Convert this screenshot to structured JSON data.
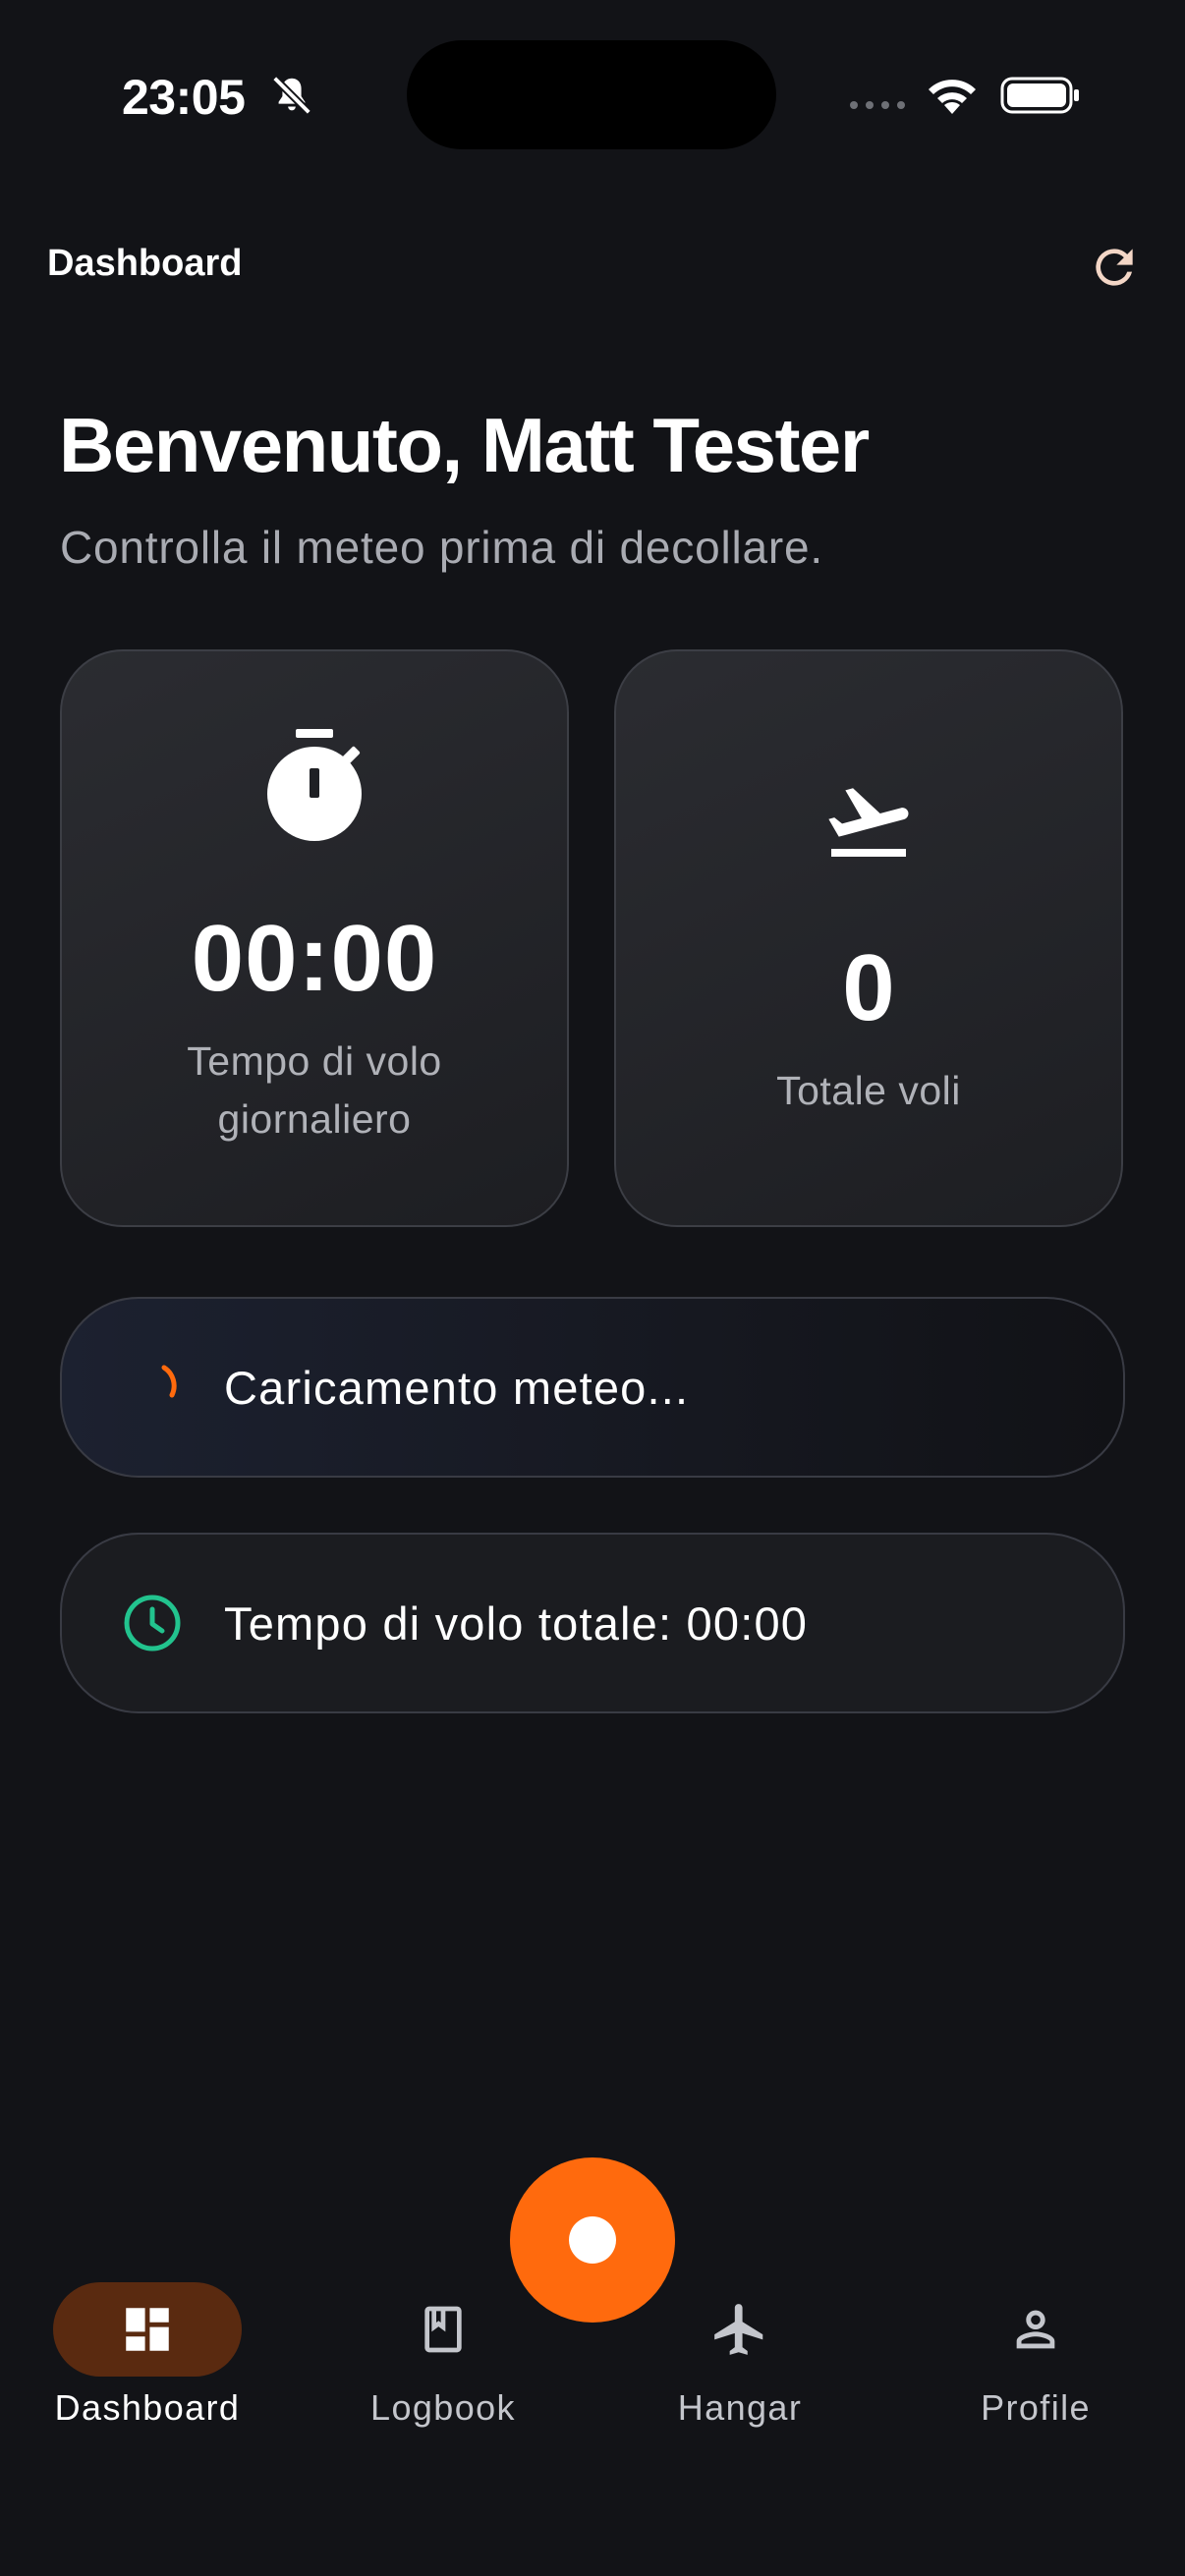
{
  "status_bar": {
    "time": "23:05"
  },
  "header": {
    "title": "Dashboard"
  },
  "welcome": {
    "heading": "Benvenuto, Matt Tester",
    "subtitle": "Controlla il meteo prima di decollare."
  },
  "stats": {
    "daily_flight_time": {
      "value": "00:00",
      "label": "Tempo di volo giornaliero"
    },
    "total_flights": {
      "value": "0",
      "label": "Totale voli"
    }
  },
  "weather": {
    "status": "Caricamento meteo..."
  },
  "flight_time": {
    "text": "Tempo di volo totale: 00:00"
  },
  "nav": {
    "items": [
      {
        "label": "Dashboard",
        "icon": "dashboard-icon",
        "active": true
      },
      {
        "label": "Logbook",
        "icon": "book-icon",
        "active": false
      },
      {
        "label": "Hangar",
        "icon": "airplane-icon",
        "active": false
      },
      {
        "label": "Profile",
        "icon": "person-icon",
        "active": false
      }
    ]
  },
  "colors": {
    "background": "#121317",
    "accent": "#ff6a0d",
    "active_nav_pill": "#5a2a10",
    "success": "#22c38e",
    "refresh_icon": "#f3d6c6"
  }
}
